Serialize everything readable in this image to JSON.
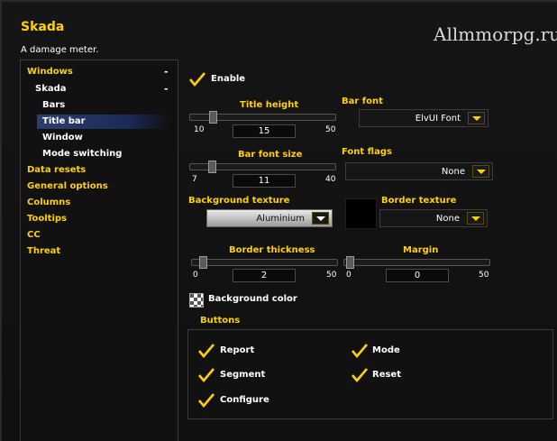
{
  "app": {
    "title": "Skada",
    "subtitle": "A damage meter.",
    "watermark": "Allmmorpg.ru"
  },
  "sidebar": {
    "windows": "Windows",
    "skada": "Skada",
    "bars": "Bars",
    "titlebar": "Title bar",
    "window": "Window",
    "mode_switching": "Mode switching",
    "data_resets": "Data resets",
    "general_options": "General options",
    "columns": "Columns",
    "tooltips": "Tooltips",
    "cc": "CC",
    "threat": "Threat",
    "collapse": "-"
  },
  "options": {
    "enable": {
      "label": "Enable",
      "checked": true
    },
    "title_height": {
      "label": "Title height",
      "min": "10",
      "max": "50",
      "value": "15",
      "fraction": 0.125
    },
    "bar_font": {
      "label": "Bar font",
      "value": "ElvUI Font"
    },
    "bar_font_size": {
      "label": "Bar font size",
      "min": "7",
      "max": "40",
      "value": "11",
      "fraction": 0.121
    },
    "font_flags": {
      "label": "Font flags",
      "value": "None"
    },
    "background_texture": {
      "label": "Background texture",
      "value": "Aluminium"
    },
    "border_texture": {
      "label": "Border texture",
      "value": "None"
    },
    "border_thickness": {
      "label": "Border thickness",
      "min": "0",
      "max": "50",
      "value": "2",
      "fraction": 0.04
    },
    "margin": {
      "label": "Margin",
      "min": "0",
      "max": "50",
      "value": "0",
      "fraction": 0.0
    },
    "background_color": {
      "label": "Background color"
    }
  },
  "buttons_group": {
    "title": "Buttons",
    "items": [
      "Report",
      "Mode",
      "Segment",
      "Reset",
      "Configure"
    ]
  },
  "colors": {
    "gold": "#ffd100",
    "selected": "#2b3f70"
  }
}
